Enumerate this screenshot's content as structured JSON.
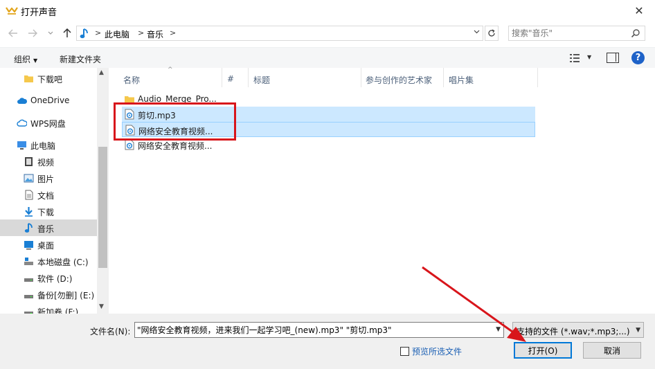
{
  "window": {
    "title": "打开声音",
    "close_glyph": "✕"
  },
  "address": {
    "crumbs": [
      "此电脑",
      "音乐"
    ],
    "separator": ">",
    "search_placeholder": "搜索\"音乐\""
  },
  "toolbar": {
    "organize_label": "组织",
    "new_folder_label": "新建文件夹"
  },
  "nav": {
    "items": [
      {
        "label": "下载吧",
        "icon": "folder-icon",
        "indent": 1
      },
      {
        "label": "OneDrive",
        "icon": "cloud-icon",
        "indent": 0
      },
      {
        "label": "WPS网盘",
        "icon": "wps-cloud-icon",
        "indent": 0
      },
      {
        "label": "此电脑",
        "icon": "computer-icon",
        "indent": 0
      },
      {
        "label": "视频",
        "icon": "video-icon",
        "indent": 1
      },
      {
        "label": "图片",
        "icon": "picture-icon",
        "indent": 1
      },
      {
        "label": "文档",
        "icon": "document-icon",
        "indent": 1
      },
      {
        "label": "下载",
        "icon": "download-icon",
        "indent": 1
      },
      {
        "label": "音乐",
        "icon": "music-icon",
        "indent": 1,
        "selected": true
      },
      {
        "label": "桌面",
        "icon": "desktop-icon",
        "indent": 1
      },
      {
        "label": "本地磁盘 (C:)",
        "icon": "system-drive-icon",
        "indent": 1
      },
      {
        "label": "软件 (D:)",
        "icon": "drive-icon",
        "indent": 1
      },
      {
        "label": "备份[勿删] (E:)",
        "icon": "drive-icon",
        "indent": 1
      },
      {
        "label": "新加卷 (F:)",
        "icon": "drive-icon",
        "indent": 1
      }
    ]
  },
  "columns": [
    "名称",
    "#",
    "标题",
    "参与创作的艺术家",
    "唱片集"
  ],
  "files": [
    {
      "name": "Audio_Merge_Pro...",
      "icon": "folder-icon",
      "selected": false
    },
    {
      "name": "剪切.mp3",
      "icon": "audio-file-icon",
      "selected": true
    },
    {
      "name": "网络安全教育视频...",
      "icon": "audio-file-icon",
      "selected": true,
      "focused": true
    },
    {
      "name": "网络安全教育视频...",
      "icon": "audio-file-icon",
      "selected": false
    }
  ],
  "bottom": {
    "filename_label": "文件名(N):",
    "filename_value": "\"网络安全教育视频，进来我们一起学习吧_(new).mp3\" \"剪切.mp3\"",
    "filter_label": "支持的文件 (*.wav;*.mp3;...)",
    "preview_label": "预览所选文件",
    "open_label": "打开(O)",
    "cancel_label": "取消"
  },
  "colors": {
    "accent": "#0078d7",
    "selection": "#cce8ff",
    "highlight_box": "#d8151b"
  }
}
